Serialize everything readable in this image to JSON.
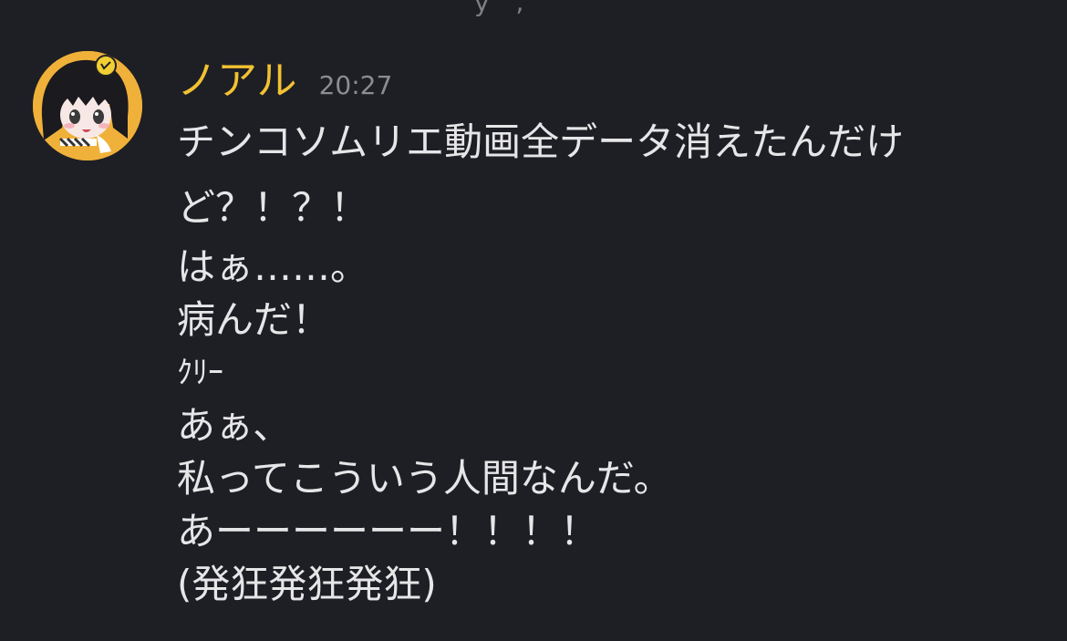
{
  "message": {
    "username": "ノアル",
    "timestamp": "20:27",
    "avatar_icon": "anime-girl-avatar-icon",
    "accent_color": "#f2c133",
    "lines": [
      "チンコソムリエ動画全データ消えたんだけど？！？！",
      "はぁ……。",
      "病んだ！",
      "ｸﾘｰ",
      "あぁ、",
      "私ってこういう人間なんだ。",
      "あーーーーーー！！！！",
      "(発狂発狂発狂)"
    ]
  },
  "top_fragment": "y ,"
}
